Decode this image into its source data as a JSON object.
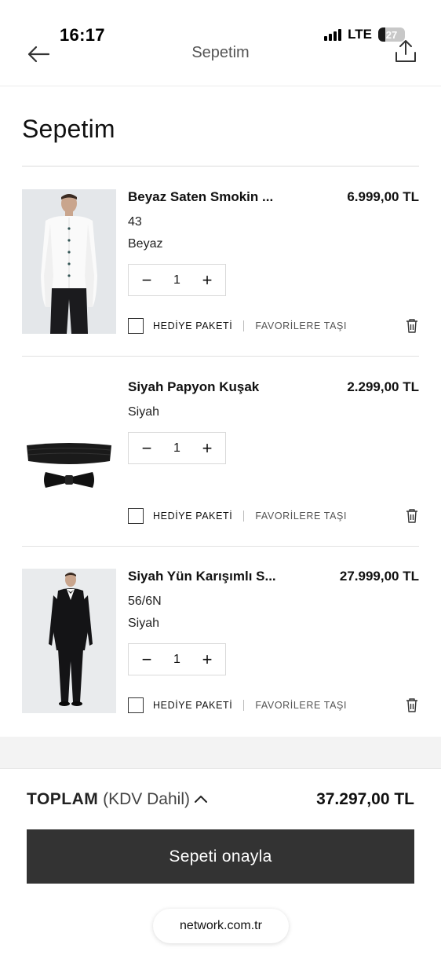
{
  "status_bar": {
    "time": "16:17",
    "network": "LTE",
    "battery": "27",
    "battery_level": 0.27
  },
  "nav": {
    "title": "Sepetim",
    "back_icon": "arrow-left-icon",
    "share_icon": "share-icon"
  },
  "page": {
    "title": "Sepetim"
  },
  "cart": {
    "items": [
      {
        "name": "Beyaz Saten Smokin ...",
        "price": "6.999,00 TL",
        "size": "43",
        "color": "Beyaz",
        "quantity": "1",
        "gift_label": "HEDİYE PAKETİ",
        "favorite_label": "FAVORİLERE TAŞI"
      },
      {
        "name": "Siyah Papyon Kuşak",
        "price": "2.299,00 TL",
        "color": "Siyah",
        "quantity": "1",
        "gift_label": "HEDİYE PAKETİ",
        "favorite_label": "FAVORİLERE TAŞI"
      },
      {
        "name": "Siyah Yün Karışımlı S...",
        "price": "27.999,00 TL",
        "size": "56/6N",
        "color": "Siyah",
        "quantity": "1",
        "gift_label": "HEDİYE PAKETİ",
        "favorite_label": "FAVORİLERE TAŞI"
      }
    ]
  },
  "summary": {
    "total_label": "TOPLAM",
    "vat_label": "(KDV Dahil)",
    "total_value": "37.297,00 TL",
    "confirm_label": "Sepeti onayla"
  },
  "browser": {
    "url": "network.com.tr"
  },
  "colors": {
    "button_bg": "#333333",
    "divider": "#e2e2e2"
  }
}
